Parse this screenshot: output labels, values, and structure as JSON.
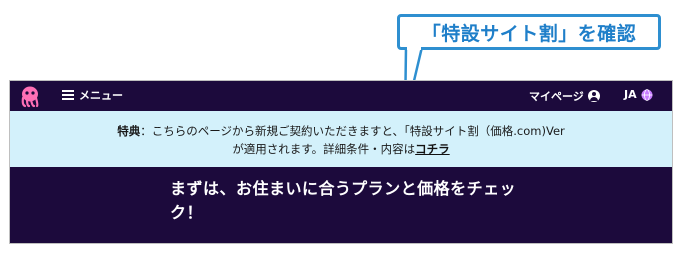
{
  "annotation": {
    "callout_text": "「特設サイト割」を確認",
    "border_color": "#2e8fd0",
    "text_color": "#1f7fc9"
  },
  "navbar": {
    "logo_icon": "octopus-logo-icon",
    "menu_label": "メニュー",
    "mypage_label": "マイページ",
    "language_label": "JA",
    "background": "#1c0a3c"
  },
  "banner": {
    "prefix": "特典",
    "separator": "：",
    "line1_body": "こちらのページから新規ご契約いただきますと、「特設サイト割（価格.com)Ver",
    "line2_body": "が適用されます。詳細条件・内容は",
    "link_label": "コチラ",
    "background": "#d3f1fb"
  },
  "hero": {
    "title": "まずは、お住まいに合うプランと価格をチェック！"
  }
}
